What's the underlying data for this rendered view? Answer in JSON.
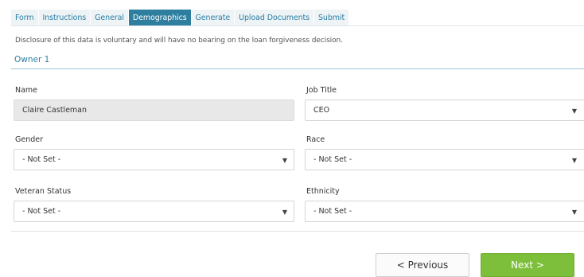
{
  "tabs": [
    {
      "label": "Form"
    },
    {
      "label": "Instructions"
    },
    {
      "label": "General"
    },
    {
      "label": "Demographics"
    },
    {
      "label": "Generate"
    },
    {
      "label": "Upload Documents"
    },
    {
      "label": "Submit"
    }
  ],
  "active_tab": "Demographics",
  "disclosure": "Disclosure of this data is voluntary and will have no bearing on the loan forgiveness decision.",
  "owner": {
    "title": "Owner 1"
  },
  "form": {
    "name": {
      "label": "Name",
      "value": "Claire Castleman"
    },
    "job_title": {
      "label": "Job Title",
      "value": "CEO"
    },
    "gender": {
      "label": "Gender",
      "value": "- Not Set -"
    },
    "race": {
      "label": "Race",
      "value": "- Not Set -"
    },
    "veteran_status": {
      "label": "Veteran Status",
      "value": "- Not Set -"
    },
    "ethnicity": {
      "label": "Ethnicity",
      "value": "- Not Set -"
    }
  },
  "buttons": {
    "previous": "< Previous",
    "next": "Next >"
  },
  "icons": {
    "dropdown": "caret-down-icon"
  },
  "colors": {
    "accent": "#2e7f9f",
    "next_button": "#7dbf3b",
    "readonly_field": "#e8e8e8"
  }
}
